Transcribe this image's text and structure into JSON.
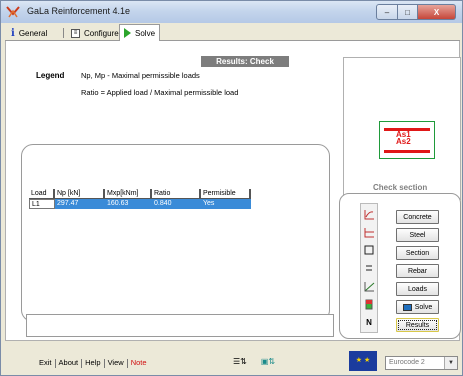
{
  "window": {
    "title": "GaLa Reinforcement  4.1e",
    "minimize": "–",
    "maximize": "□",
    "close": "X"
  },
  "tabs": [
    {
      "label": "General",
      "icon": "info-icon"
    },
    {
      "label": "Configure",
      "icon": "configure-icon"
    },
    {
      "label": "Solve",
      "icon": "play-icon"
    }
  ],
  "results": {
    "header": "Results: Check section",
    "legend_title": "Legend",
    "legend_lines": [
      "Np, Mp  - Maximal permissible loads",
      "Ratio  =  Applied load / Maximal permissible load"
    ]
  },
  "table": {
    "columns": [
      "Load",
      "Np [kN]",
      "Mxp[kNm]",
      "Ratio",
      "Permisible"
    ],
    "rows": [
      {
        "load": "L1",
        "np": "297.47",
        "mxp": "160.63",
        "ratio": "0.840",
        "permissible": "Yes"
      }
    ]
  },
  "preview": {
    "labels": [
      "As1",
      "As2"
    ]
  },
  "check_section": {
    "title": "Check section",
    "buttons": [
      "Concrete",
      "Steel",
      "Section",
      "Rebar",
      "Loads",
      "Solve",
      "Results"
    ]
  },
  "bottom": {
    "menu": [
      "Exit",
      "About",
      "Help",
      "View",
      "Note"
    ],
    "code": "Eurocode 2",
    "flag_text": "★ ★"
  },
  "colors": {
    "accent_selection": "#3a8bd8",
    "rebar": "#e01818",
    "section_outline": "#1f9a3a",
    "note": "#d01010"
  }
}
